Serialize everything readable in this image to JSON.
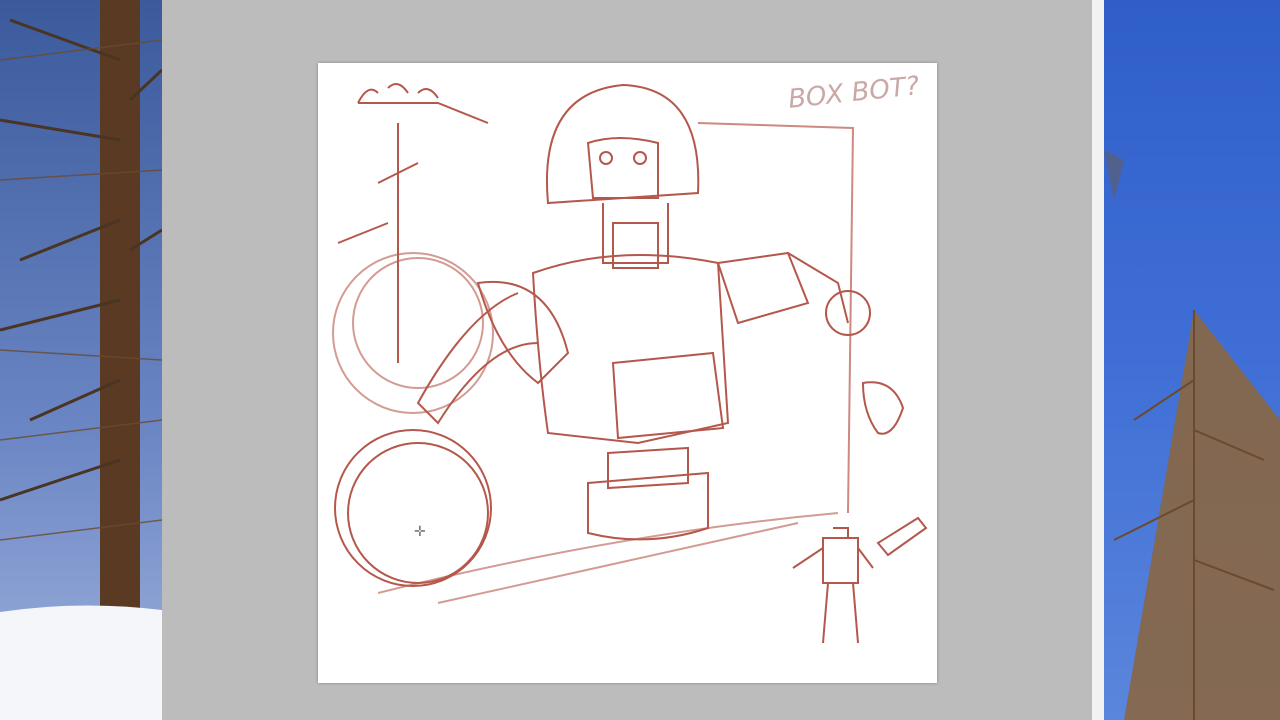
{
  "canvas": {
    "sketch_note": "BOX BOT?",
    "stroke_color": "#a83a2c",
    "background": "#ffffff"
  },
  "workspace_color": "#bcbcbc",
  "cursor_icon": "crosshair-icon"
}
